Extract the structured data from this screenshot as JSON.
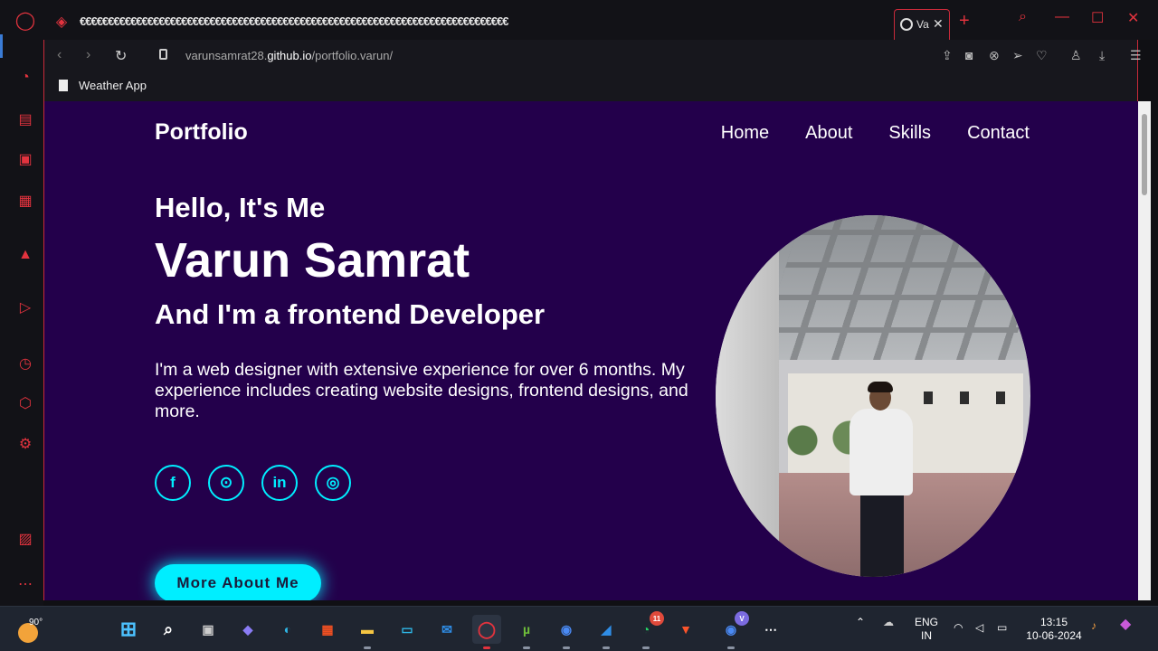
{
  "browser": {
    "tab_ghost_text": "€€€€€€€€€€€€€€€€€€€€€€€€€€€€€€€€€€€€€€€€€€€€€€€€€€€€€€€€€€€€€€€€€€€€€€€€€€€€",
    "active_tab_title": "Va",
    "url_prefix": "varunsamrat28.",
    "url_domain": "github.io",
    "url_path": "/portfolio.varun/",
    "bookmark_label": "Weather App"
  },
  "site": {
    "brand": "Portfolio",
    "nav": [
      "Home",
      "About",
      "Skills",
      "Contact"
    ],
    "hello": "Hello, It's Me",
    "name": "Varun Samrat",
    "role": "And I'm a frontend Developer",
    "bio": "I'm a web designer with extensive experience for over 6 months. My experience includes creating website designs, frontend designs, and more.",
    "socials": [
      {
        "icon": "facebook-icon",
        "glyph": "f"
      },
      {
        "icon": "github-icon",
        "glyph": "⊙"
      },
      {
        "icon": "linkedin-icon",
        "glyph": "in"
      },
      {
        "icon": "instagram-icon",
        "glyph": "◎"
      }
    ],
    "cta": "More About Me",
    "colors": {
      "background": "#23004b",
      "accent": "#00eeff",
      "text": "#ffffff"
    }
  },
  "taskbar": {
    "temperature": "90°",
    "lang_top": "ENG",
    "lang_bottom": "IN",
    "time": "13:15",
    "date": "10-06-2024",
    "whatsapp_badge": "11",
    "chrome_badge": "V"
  }
}
